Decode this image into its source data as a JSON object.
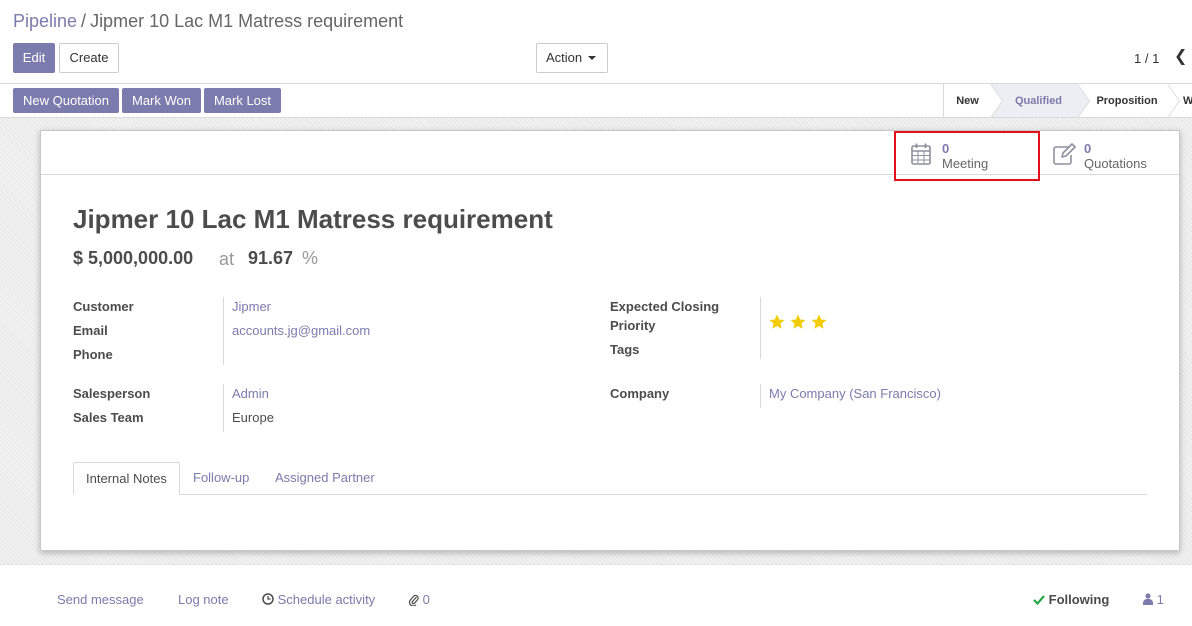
{
  "breadcrumb": {
    "parent": "Pipeline",
    "separator": "/",
    "current": "Jipmer 10 Lac M1 Matress requirement"
  },
  "toolbar": {
    "edit_label": "Edit",
    "create_label": "Create",
    "action_label": "Action"
  },
  "pager": {
    "value": "1 / 1",
    "prev_glyph": "❮"
  },
  "header_buttons": {
    "new_quotation": "New Quotation",
    "mark_won": "Mark Won",
    "mark_lost": "Mark Lost"
  },
  "stages": {
    "new": "New",
    "qualified": "Qualified",
    "proposition": "Proposition",
    "won": "W",
    "active": "Qualified"
  },
  "smart_buttons": {
    "meeting": {
      "value": "0",
      "label": "Meeting",
      "icon": "calendar-icon"
    },
    "quotations": {
      "value": "0",
      "label": "Quotations",
      "icon": "pencil-square-icon"
    }
  },
  "record": {
    "title": "Jipmer 10 Lac M1 Matress requirement",
    "expected_revenue": "$ 5,000,000.00",
    "at_label": "at",
    "probability": "91.67",
    "percent": "%"
  },
  "fields": {
    "customer_label": "Customer",
    "customer": "Jipmer",
    "email_label": "Email",
    "email": "accounts.jg@gmail.com",
    "phone_label": "Phone",
    "expected_closing_label": "Expected Closing",
    "priority_label": "Priority",
    "priority_stars": 3,
    "tags_label": "Tags",
    "salesperson_label": "Salesperson",
    "salesperson": "Admin",
    "sales_team_label": "Sales Team",
    "sales_team": "Europe",
    "company_label": "Company",
    "company": "My Company (San Francisco)"
  },
  "tabs": {
    "internal_notes": "Internal Notes",
    "follow_up": "Follow-up",
    "assigned_partner": "Assigned Partner"
  },
  "chatter": {
    "send_message": "Send message",
    "log_note": "Log note",
    "schedule_activity": "Schedule activity",
    "attachments": "0",
    "following": "Following",
    "followers": "1"
  },
  "colors": {
    "brand": "#7c7bad",
    "highlight": "#e0111b",
    "star": "#f3cc00",
    "following_check": "#28a745"
  }
}
